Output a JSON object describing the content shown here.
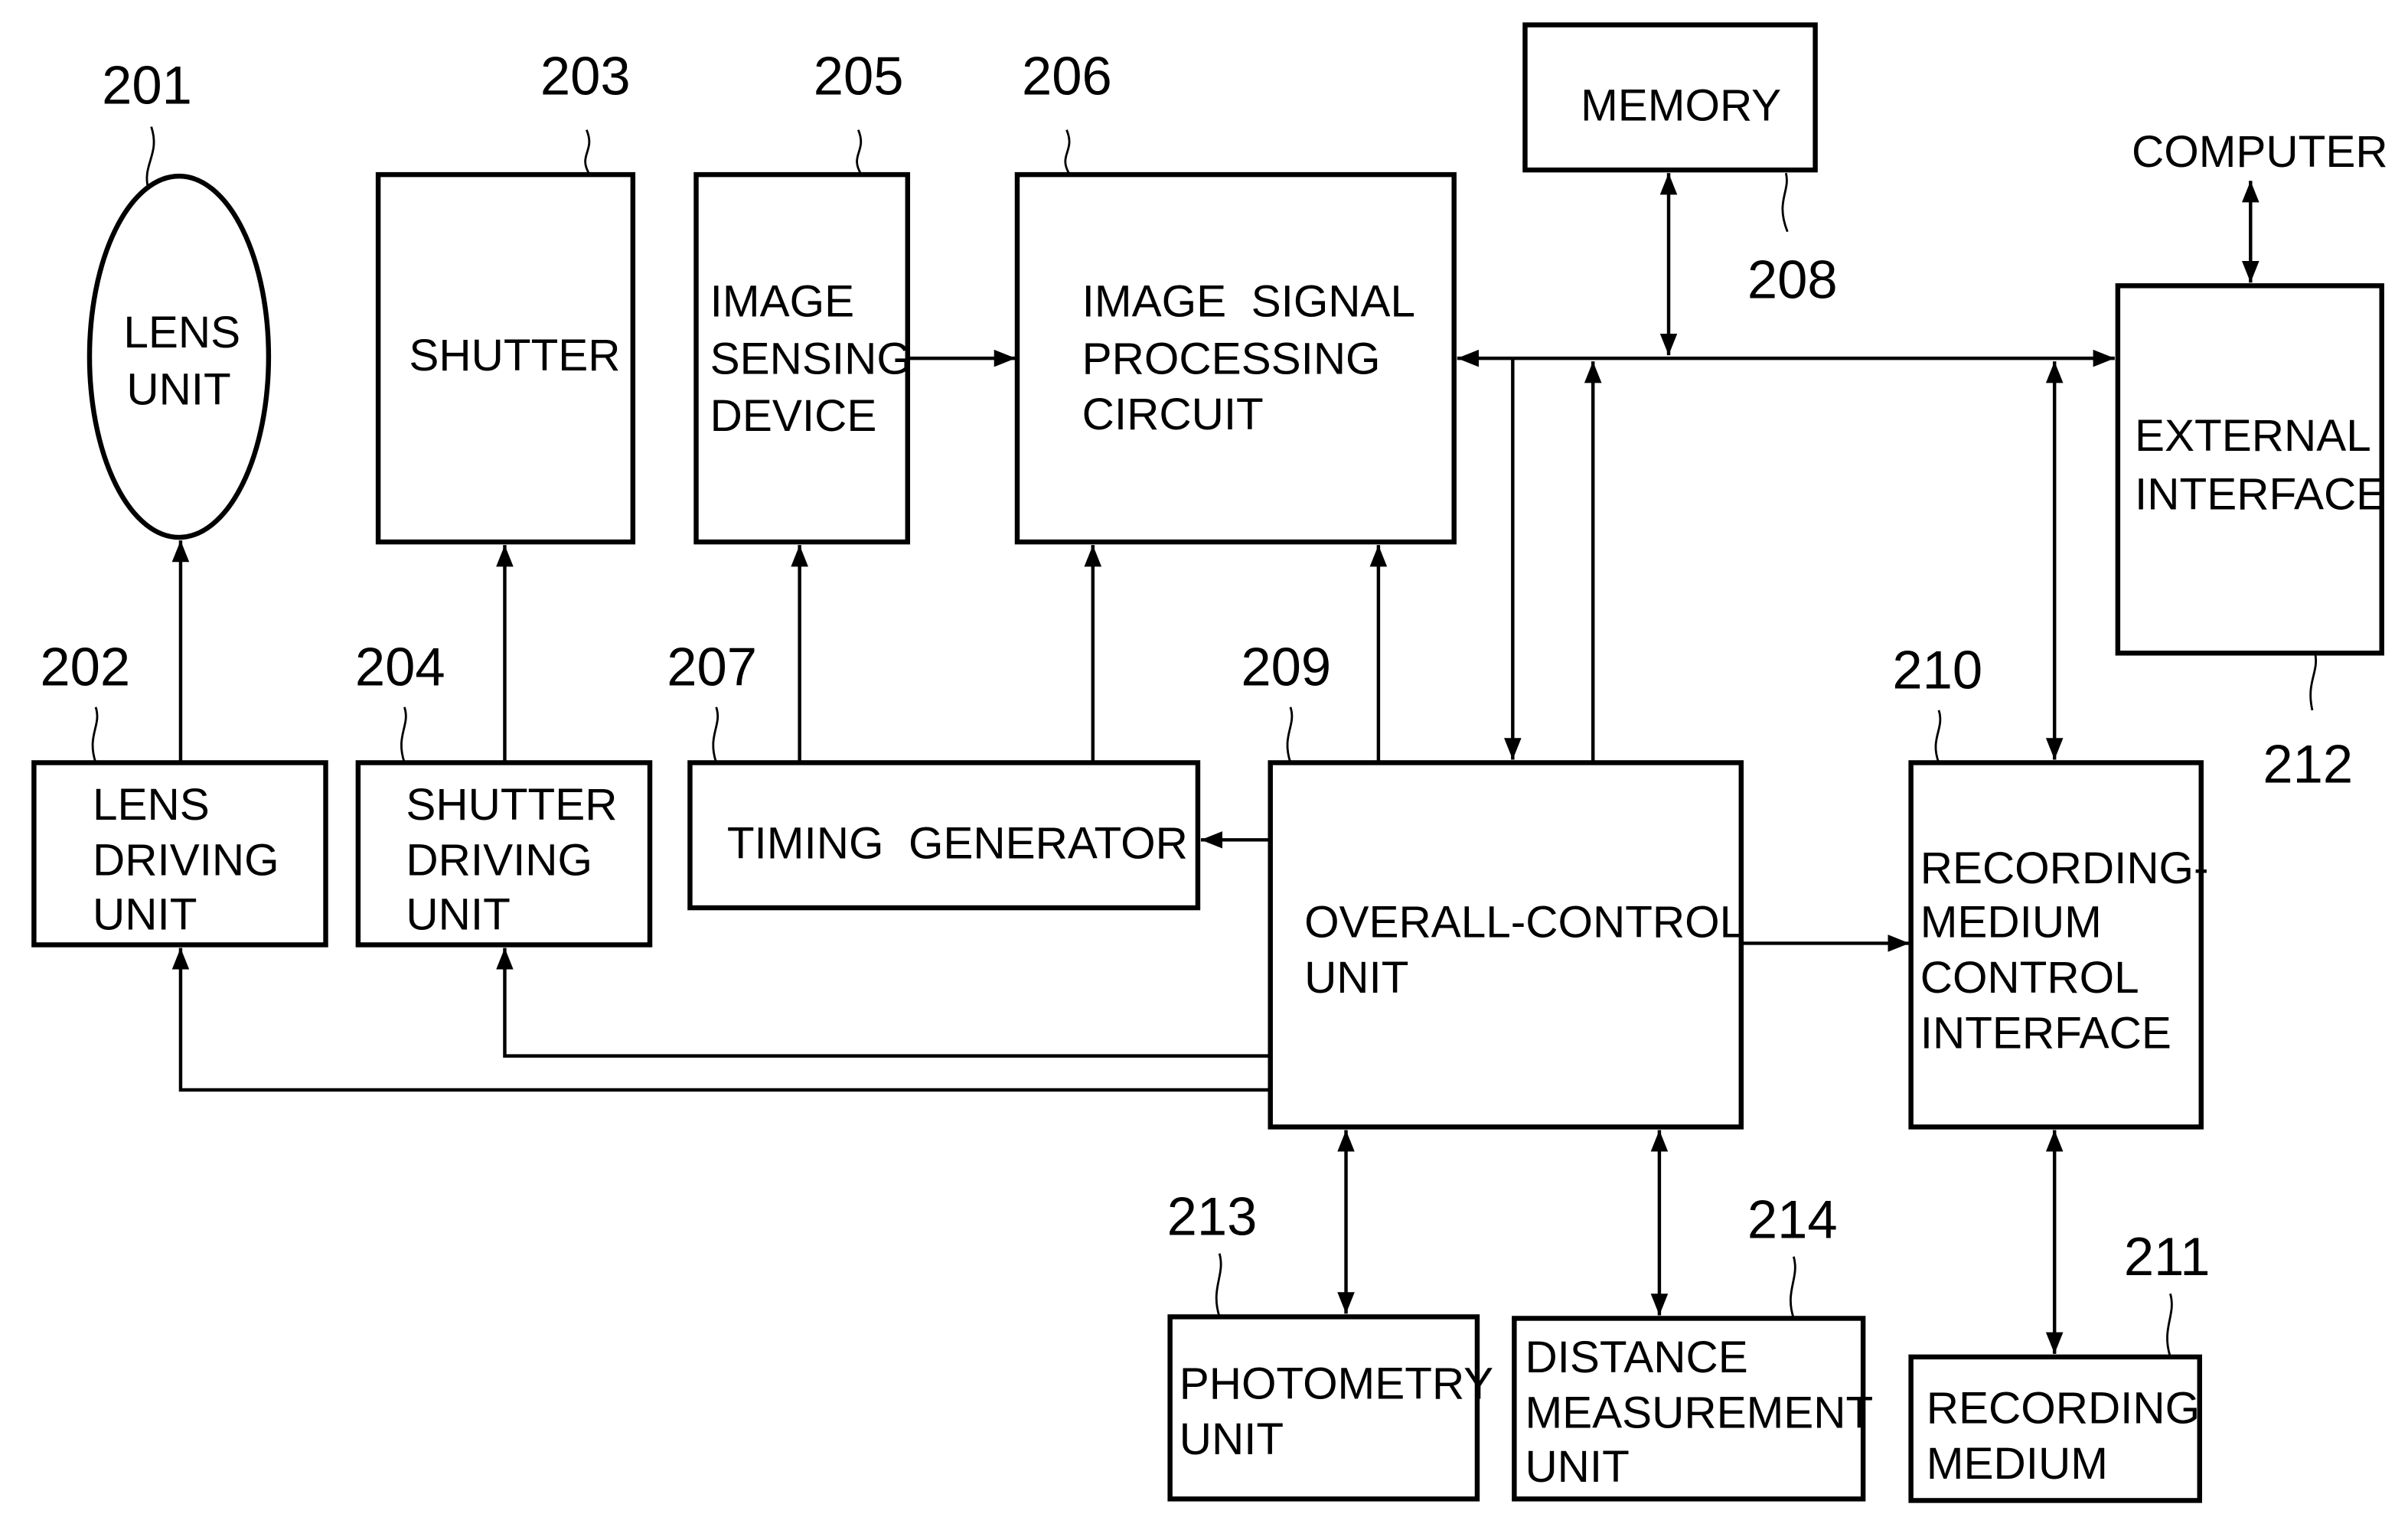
{
  "figure": {
    "blocks": {
      "lens_unit": {
        "ref": "201",
        "lines": [
          "LENS",
          "UNIT"
        ]
      },
      "lens_driving_unit": {
        "ref": "202",
        "lines": [
          "LENS",
          "DRIVING",
          "UNIT"
        ]
      },
      "shutter": {
        "ref": "203",
        "lines": [
          "SHUTTER"
        ]
      },
      "shutter_driving_unit": {
        "ref": "204",
        "lines": [
          "SHUTTER",
          "DRIVING",
          "UNIT"
        ]
      },
      "image_sensing_device": {
        "ref": "205",
        "lines": [
          "IMAGE",
          "SENSING",
          "DEVICE"
        ]
      },
      "image_signal_processing_circuit": {
        "ref": "206",
        "lines": [
          "IMAGE  SIGNAL",
          "PROCESSING",
          "CIRCUIT"
        ]
      },
      "timing_generator": {
        "ref": "207",
        "lines": [
          "TIMING  GENERATOR"
        ]
      },
      "memory": {
        "ref": "208",
        "lines": [
          "MEMORY"
        ]
      },
      "overall_control_unit": {
        "ref": "209",
        "lines": [
          "OVERALL-CONTROL",
          "UNIT"
        ]
      },
      "recording_medium_control_interface": {
        "ref": "210",
        "lines": [
          "RECORDING-",
          "MEDIUM",
          "CONTROL",
          "INTERFACE"
        ]
      },
      "recording_medium": {
        "ref": "211",
        "lines": [
          "RECORDING",
          "MEDIUM"
        ]
      },
      "external_interface": {
        "ref": "212",
        "lines": [
          "EXTERNAL",
          "INTERFACE"
        ]
      },
      "photometry_unit": {
        "ref": "213",
        "lines": [
          "PHOTOMETRY",
          "UNIT"
        ]
      },
      "distance_measurement_unit": {
        "ref": "214",
        "lines": [
          "DISTANCE",
          "MEASUREMENT",
          "UNIT"
        ]
      }
    },
    "external_label": "COMPUTER",
    "connections": [
      {
        "from": "lens_driving_unit",
        "to": "lens_unit",
        "direction": "one-way"
      },
      {
        "from": "shutter_driving_unit",
        "to": "shutter",
        "direction": "one-way"
      },
      {
        "from": "image_sensing_device",
        "to": "image_signal_processing_circuit",
        "direction": "one-way"
      },
      {
        "from": "timing_generator",
        "to": "image_sensing_device",
        "direction": "one-way"
      },
      {
        "from": "timing_generator",
        "to": "image_signal_processing_circuit",
        "direction": "one-way"
      },
      {
        "from": "overall_control_unit",
        "to": "image_signal_processing_circuit",
        "direction": "one-way"
      },
      {
        "from": "overall_control_unit",
        "to": "timing_generator",
        "direction": "one-way"
      },
      {
        "from": "overall_control_unit",
        "to": "lens_driving_unit",
        "direction": "one-way"
      },
      {
        "from": "overall_control_unit",
        "to": "shutter_driving_unit",
        "direction": "one-way"
      },
      {
        "from": "overall_control_unit",
        "to": "recording_medium_control_interface",
        "direction": "one-way"
      },
      {
        "from": "bus",
        "to": "image_signal_processing_circuit",
        "direction": "one-way"
      },
      {
        "from": "bus",
        "to": "overall_control_unit",
        "direction": "one-way"
      },
      {
        "from": "overall_control_unit",
        "to": "bus",
        "direction": "one-way"
      },
      {
        "from": "bus",
        "to": "external_interface",
        "direction": "one-way"
      },
      {
        "from": "memory",
        "to": "bus",
        "direction": "two-way"
      },
      {
        "from": "recording_medium_control_interface",
        "to": "bus",
        "direction": "two-way"
      },
      {
        "from": "external_interface",
        "to": "COMPUTER",
        "direction": "two-way"
      },
      {
        "from": "overall_control_unit",
        "to": "photometry_unit",
        "direction": "two-way"
      },
      {
        "from": "overall_control_unit",
        "to": "distance_measurement_unit",
        "direction": "two-way"
      },
      {
        "from": "recording_medium_control_interface",
        "to": "recording_medium",
        "direction": "two-way"
      }
    ]
  }
}
